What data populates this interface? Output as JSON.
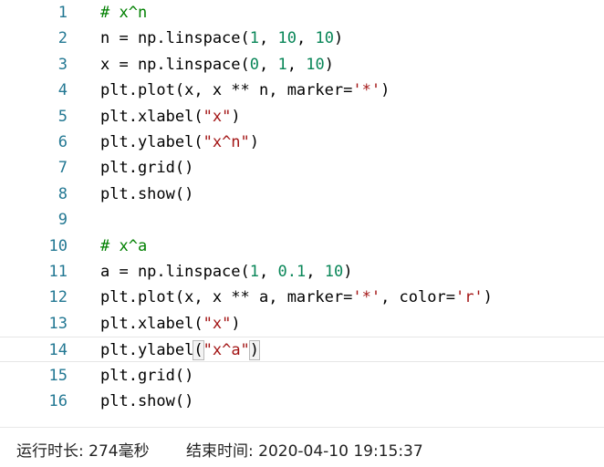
{
  "editor": {
    "lines": [
      {
        "number": "1",
        "segments": [
          {
            "text": "# x^n",
            "kind": "comment"
          }
        ]
      },
      {
        "number": "2",
        "segments": [
          {
            "text": "n = np.linspace(",
            "kind": "plain"
          },
          {
            "text": "1",
            "kind": "num"
          },
          {
            "text": ", ",
            "kind": "plain"
          },
          {
            "text": "10",
            "kind": "num"
          },
          {
            "text": ", ",
            "kind": "plain"
          },
          {
            "text": "10",
            "kind": "num"
          },
          {
            "text": ")",
            "kind": "plain"
          }
        ]
      },
      {
        "number": "3",
        "segments": [
          {
            "text": "x = np.linspace(",
            "kind": "plain"
          },
          {
            "text": "0",
            "kind": "num"
          },
          {
            "text": ", ",
            "kind": "plain"
          },
          {
            "text": "1",
            "kind": "num"
          },
          {
            "text": ", ",
            "kind": "plain"
          },
          {
            "text": "10",
            "kind": "num"
          },
          {
            "text": ")",
            "kind": "plain"
          }
        ]
      },
      {
        "number": "4",
        "segments": [
          {
            "text": "plt.plot(x, x ** n, marker=",
            "kind": "plain"
          },
          {
            "text": "'*'",
            "kind": "str"
          },
          {
            "text": ")",
            "kind": "plain"
          }
        ]
      },
      {
        "number": "5",
        "segments": [
          {
            "text": "plt.xlabel(",
            "kind": "plain"
          },
          {
            "text": "\"x\"",
            "kind": "str"
          },
          {
            "text": ")",
            "kind": "plain"
          }
        ]
      },
      {
        "number": "6",
        "segments": [
          {
            "text": "plt.ylabel(",
            "kind": "plain"
          },
          {
            "text": "\"x^n\"",
            "kind": "str"
          },
          {
            "text": ")",
            "kind": "plain"
          }
        ]
      },
      {
        "number": "7",
        "segments": [
          {
            "text": "plt.grid()",
            "kind": "plain"
          }
        ]
      },
      {
        "number": "8",
        "segments": [
          {
            "text": "plt.show()",
            "kind": "plain"
          }
        ]
      },
      {
        "number": "9",
        "segments": []
      },
      {
        "number": "10",
        "segments": [
          {
            "text": "# x^a",
            "kind": "comment"
          }
        ]
      },
      {
        "number": "11",
        "segments": [
          {
            "text": "a = np.linspace(",
            "kind": "plain"
          },
          {
            "text": "1",
            "kind": "num"
          },
          {
            "text": ", ",
            "kind": "plain"
          },
          {
            "text": "0.1",
            "kind": "num"
          },
          {
            "text": ", ",
            "kind": "plain"
          },
          {
            "text": "10",
            "kind": "num"
          },
          {
            "text": ")",
            "kind": "plain"
          }
        ]
      },
      {
        "number": "12",
        "segments": [
          {
            "text": "plt.plot(x, x ** a, marker=",
            "kind": "plain"
          },
          {
            "text": "'*'",
            "kind": "str"
          },
          {
            "text": ", color=",
            "kind": "plain"
          },
          {
            "text": "'r'",
            "kind": "str"
          },
          {
            "text": ")",
            "kind": "plain"
          }
        ]
      },
      {
        "number": "13",
        "segments": [
          {
            "text": "plt.xlabel(",
            "kind": "plain"
          },
          {
            "text": "\"x\"",
            "kind": "str"
          },
          {
            "text": ")",
            "kind": "plain"
          }
        ]
      },
      {
        "number": "14",
        "current": true,
        "segments": [
          {
            "text": "plt.ylabel",
            "kind": "plain"
          },
          {
            "text": "(",
            "kind": "bracket"
          },
          {
            "text": "\"x^a\"",
            "kind": "str"
          },
          {
            "text": ")",
            "kind": "bracket"
          }
        ]
      },
      {
        "number": "15",
        "segments": [
          {
            "text": "plt.grid()",
            "kind": "plain"
          }
        ]
      },
      {
        "number": "16",
        "segments": [
          {
            "text": "plt.show()",
            "kind": "plain"
          }
        ]
      }
    ]
  },
  "status": {
    "runtime": "运行时长: 274毫秒",
    "end_time": "结束时间: 2020-04-10 19:15:37"
  },
  "colors": {
    "line_number": "#237893",
    "comment": "#008000",
    "number": "#098658",
    "string": "#a31515"
  }
}
